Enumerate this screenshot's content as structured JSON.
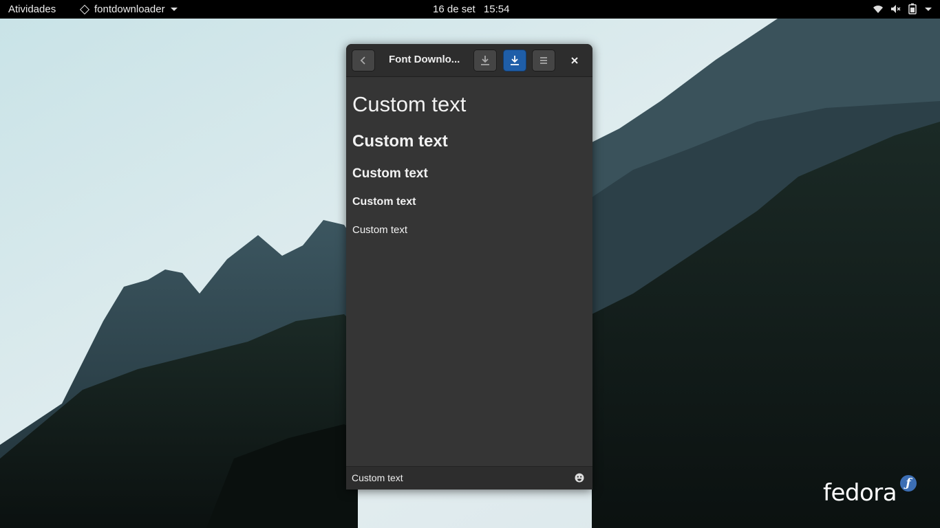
{
  "topbar": {
    "activities": "Atividades",
    "app_name": "fontdownloader",
    "date": "16 de set",
    "time": "15:54"
  },
  "window": {
    "title": "Font Downlo...",
    "accent_color": "#1f5ea8"
  },
  "preview": {
    "lines": [
      "Custom text",
      "Custom text",
      "Custom text",
      "Custom text",
      "Custom text"
    ]
  },
  "entry": {
    "value": "Custom text"
  },
  "desktop": {
    "logo_text": "fedora"
  }
}
